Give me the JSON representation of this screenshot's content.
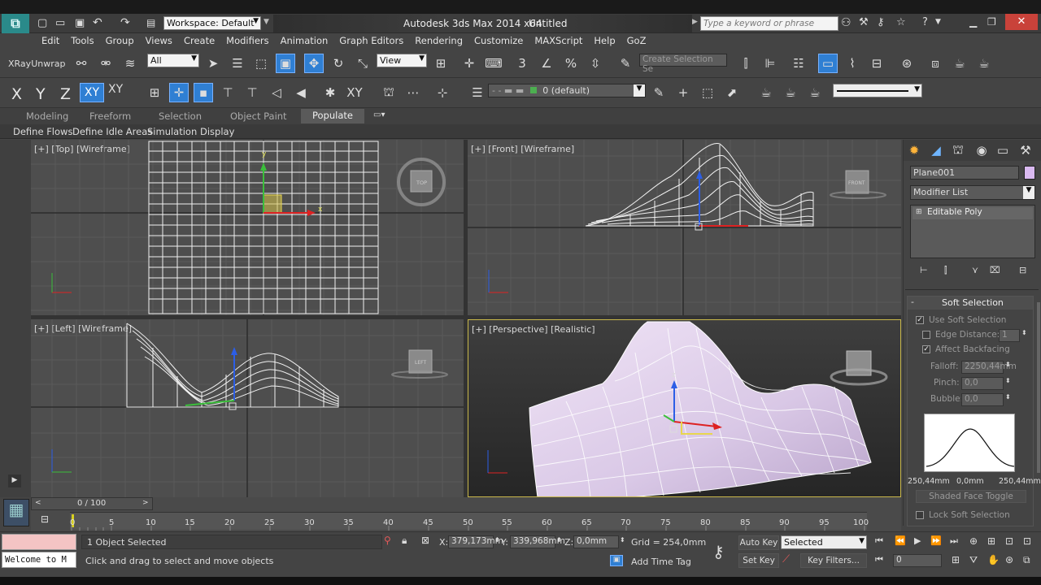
{
  "titlebar": {
    "workspace": "Workspace: Default",
    "app_title": "Autodesk 3ds Max  2014 x64",
    "doc_title": "Untitled",
    "search_placeholder": "Type a keyword or phrase"
  },
  "menu": [
    "Edit",
    "Tools",
    "Group",
    "Views",
    "Create",
    "Modifiers",
    "Animation",
    "Graph Editors",
    "Rendering",
    "Customize",
    "MAXScript",
    "Help",
    "GoZ"
  ],
  "toolbar1": {
    "plugin_label": "XRayUnwrap",
    "filter_value": "All",
    "refcoord_value": "View",
    "selset_placeholder": "Create Selection Se"
  },
  "toolbar2": {
    "axes": [
      "X",
      "Y",
      "Z",
      "XY",
      "XY"
    ],
    "layer_value": "0 (default)"
  },
  "ribbon": {
    "tabs": [
      "Modeling",
      "Freeform",
      "Selection",
      "Object Paint",
      "Populate"
    ],
    "active": "Populate",
    "subtabs": [
      "Define Flows",
      "Define Idle Areas",
      "Simulation",
      "Display"
    ]
  },
  "viewports": {
    "top": "[+] [Top] [Wireframe]",
    "front": "[+] [Front] [Wireframe]",
    "left": "[+] [Left] [Wireframe]",
    "perspective": "[+] [Perspective] [Realistic]",
    "viewcube_top": "TOP",
    "viewcube_front": "FRONT",
    "viewcube_left": "LEFT"
  },
  "panel": {
    "object_name": "Plane001",
    "modifier_list": "Modifier List",
    "stack_item": "Editable Poly",
    "rollout_title": "Soft Selection",
    "use_soft_selection": "Use Soft Selection",
    "edge_distance": "Edge Distance:",
    "edge_distance_value": "1",
    "affect_backfacing": "Affect Backfacing",
    "falloff_label": "Falloff:",
    "falloff_value": "2250,44mm",
    "pinch_label": "Pinch:",
    "pinch_value": "0,0",
    "bubble_label": "Bubble:",
    "bubble_value": "0,0",
    "curve_left": "250,44mm",
    "curve_mid": "0,0mm",
    "curve_right": "250,44mm",
    "shaded_face_toggle": "Shaded Face Toggle",
    "lock_soft_selection": "Lock Soft Selection"
  },
  "timeline": {
    "frame_counter": "0 / 100",
    "ticks": [
      "0",
      "5",
      "10",
      "15",
      "20",
      "25",
      "30",
      "35",
      "40",
      "45",
      "50",
      "55",
      "60",
      "65",
      "70",
      "75",
      "80",
      "85",
      "90",
      "95",
      "100"
    ]
  },
  "status": {
    "welcome": "Welcome to M",
    "selected_count": "1 Object Selected",
    "prompt": "Click and drag to select and move objects",
    "x_label": "X:",
    "x_value": "379,173mm",
    "y_label": "Y:",
    "y_value": "339,968mm",
    "z_label": "Z:",
    "z_value": "0,0mm",
    "grid": "Grid = 254,0mm",
    "add_time_tag": "Add Time Tag",
    "auto_key": "Auto Key",
    "set_key": "Set Key",
    "selected_dropdown": "Selected",
    "key_filters": "Key Filters...",
    "frame_value": "0"
  }
}
